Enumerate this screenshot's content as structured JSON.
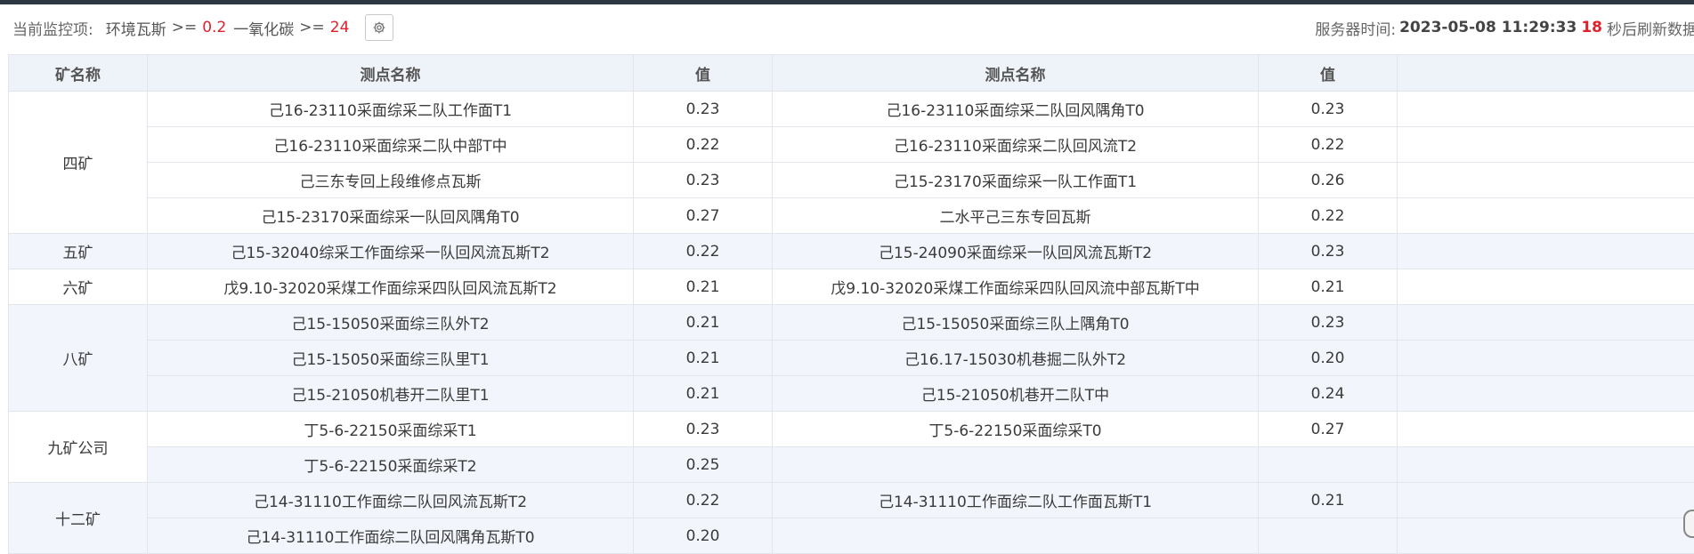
{
  "header": {
    "monitor_label": "当前监控项:",
    "item1_name": "环境瓦斯",
    "item1_op": ">=",
    "item1_value": "0.2",
    "item2_name": "一氧化碳",
    "item2_op": ">=",
    "item2_value": "24",
    "settings_icon": "gear-icon",
    "server_time_label": "服务器时间:",
    "server_time": "2023-05-08 11:29:33",
    "refresh_seconds": "18",
    "refresh_text": "秒后刷新数据"
  },
  "table": {
    "columns": [
      "矿名称",
      "测点名称",
      "值",
      "测点名称",
      "值"
    ],
    "groups": [
      {
        "mine": "四矿",
        "rows": [
          [
            "己16-23110采面综采二队工作面T1",
            "0.23",
            "己16-23110采面综采二队回风隅角T0",
            "0.23"
          ],
          [
            "己16-23110采面综采二队中部T中",
            "0.22",
            "己16-23110采面综采二队回风流T2",
            "0.22"
          ],
          [
            "己三东专回上段维修点瓦斯",
            "0.23",
            "己15-23170采面综采一队工作面T1",
            "0.26"
          ],
          [
            "己15-23170采面综采一队回风隅角T0",
            "0.27",
            "二水平己三东专回瓦斯",
            "0.22"
          ]
        ]
      },
      {
        "mine": "五矿",
        "rows": [
          [
            "己15-32040综采工作面综采一队回风流瓦斯T2",
            "0.22",
            "己15-24090采面综采一队回风流瓦斯T2",
            "0.23"
          ]
        ]
      },
      {
        "mine": "六矿",
        "rows": [
          [
            "戊9.10-32020采煤工作面综采四队回风流瓦斯T2",
            "0.21",
            "戊9.10-32020采煤工作面综采四队回风流中部瓦斯T中",
            "0.21"
          ]
        ]
      },
      {
        "mine": "八矿",
        "rows": [
          [
            "己15-15050采面综三队外T2",
            "0.21",
            "己15-15050采面综三队上隅角T0",
            "0.23"
          ],
          [
            "己15-15050采面综三队里T1",
            "0.21",
            "己16.17-15030机巷掘二队外T2",
            "0.20"
          ],
          [
            "己15-21050机巷开二队里T1",
            "0.21",
            "己15-21050机巷开二队T中",
            "0.24"
          ]
        ]
      },
      {
        "mine": "九矿公司",
        "rows": [
          [
            "丁5-6-22150采面综采T1",
            "0.23",
            "丁5-6-22150采面综采T0",
            "0.27"
          ],
          [
            "丁5-6-22150采面综采T2",
            "0.25",
            "",
            ""
          ]
        ]
      },
      {
        "mine": "十二矿",
        "rows": [
          [
            "己14-31110工作面综二队回风流瓦斯T2",
            "0.22",
            "己14-31110工作面综二队工作面瓦斯T1",
            "0.21"
          ],
          [
            "己14-31110工作面综二队回风隅角瓦斯T0",
            "0.20",
            "",
            ""
          ]
        ]
      }
    ]
  },
  "colors": {
    "header_bg": "#eef3fa",
    "alt_row_bg": "#f2f6fc",
    "alert_red": "#e0202b",
    "top_strip": "#2d3744"
  }
}
